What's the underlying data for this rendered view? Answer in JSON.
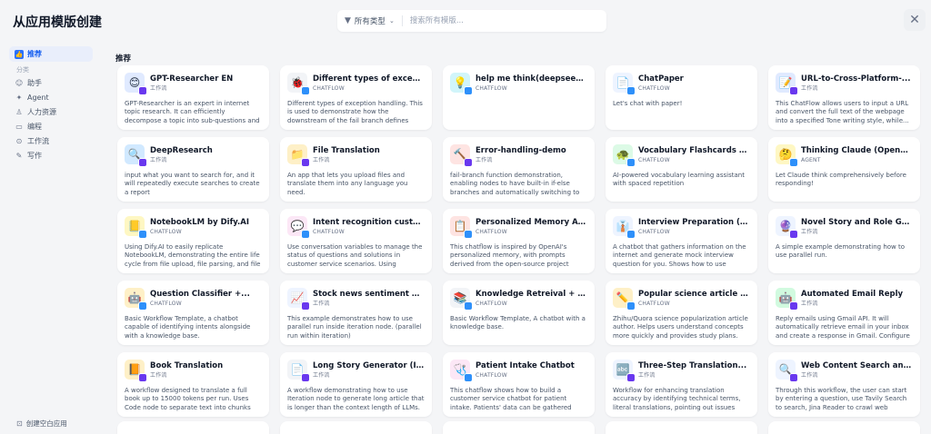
{
  "modal": {
    "title": "从应用模版创建",
    "close_icon": "close-icon"
  },
  "search": {
    "type_label": "所有类型",
    "placeholder": "搜索所有模版..."
  },
  "sidebar": {
    "recommended": "推荐",
    "category_label": "分类",
    "items": [
      {
        "label": "助手",
        "icon": "assistant-icon"
      },
      {
        "label": "Agent",
        "icon": "agent-icon"
      },
      {
        "label": "人力资源",
        "icon": "hr-icon"
      },
      {
        "label": "编程",
        "icon": "code-icon"
      },
      {
        "label": "工作流",
        "icon": "workflow-icon"
      },
      {
        "label": "写作",
        "icon": "writing-icon"
      }
    ],
    "create_blank": "创建空白应用"
  },
  "section_title": "推荐",
  "colors": {
    "accent": "#155eef",
    "workflow_badge": "#6938ef",
    "chatflow_badge": "#2e90fa"
  },
  "cards": [
    {
      "title": "GPT-Researcher EN",
      "type": "工作流",
      "desc": "GPT-Researcher is an expert in internet topic research. It can efficiently decompose a topic into sub-questions and provide a professional...",
      "icon": "😊",
      "bg": "#e0eaff",
      "badge": "wf"
    },
    {
      "title": "Different types of exception...",
      "type": "CHATFLOW",
      "desc": "Different types of exception handling. This is used to demonstrate how the downstream of the fail branch defines different strategies...",
      "icon": "🐞",
      "bg": "#f2f4f7",
      "badge": "cf"
    },
    {
      "title": "help me think(deepseek r1)",
      "type": "CHATFLOW",
      "desc": "",
      "icon": "💡",
      "bg": "#d1f5fa",
      "badge": "cf"
    },
    {
      "title": "ChatPaper",
      "type": "CHATFLOW",
      "desc": "Let's chat with paper!",
      "icon": "📄",
      "bg": "#eef4ff",
      "badge": "cf"
    },
    {
      "title": "URL-to-Cross-Platform-...",
      "type": "工作流",
      "desc": "This ChatFlow allows users to input a URL and convert the full text of the webpage into a specified Tone writing style, while...",
      "icon": "📝",
      "bg": "#e0eaff",
      "badge": "wf"
    },
    {
      "title": "DeepResearch",
      "type": "工作流",
      "desc": "input what you want to search for, and it will repeatedly execute searches to create a report",
      "icon": "🔍",
      "bg": "#d1e9ff",
      "badge": "wf"
    },
    {
      "title": "File Translation",
      "type": "工作流",
      "desc": "An app that lets you upload files and translate them into any language you need.",
      "icon": "📁",
      "bg": "#fef0c7",
      "badge": "wf"
    },
    {
      "title": "Error-handling-demo",
      "type": "工作流",
      "desc": "fail-branch function demonstration, enabling nodes to have built-in if-else branches and automatically switching to the failure branch...",
      "icon": "🔨",
      "bg": "#fee4e2",
      "badge": "wf"
    },
    {
      "title": "Vocabulary Flashcards (chatflo...",
      "type": "CHATFLOW",
      "desc": "AI-powered vocabulary learning assistant with spaced repetition",
      "icon": "🐢",
      "bg": "#dcfae6",
      "badge": "cf"
    },
    {
      "title": "Thinking Claude (OpenAI O1...",
      "type": "AGENT",
      "desc": "Let Claude think comprehensively before responding!",
      "icon": "🤔",
      "bg": "#fef7c3",
      "badge": "cf"
    },
    {
      "title": "NotebookLM by Dify.AI",
      "type": "CHATFLOW",
      "desc": "Using Dify.AI to easily replicate NotebookLM, demonstrating the entire life cycle from file upload, file parsing, and file referencing to file...",
      "icon": "📒",
      "bg": "#fef7c3",
      "badge": "cf"
    },
    {
      "title": "Intent recognition customer...",
      "type": "CHATFLOW",
      "desc": "Use conversation variables to manage the status of questions and solutions in customer service scenarios. Using conversation variable and...",
      "icon": "💬",
      "bg": "#fce7f6",
      "badge": "cf"
    },
    {
      "title": "Personalized Memory Assistant",
      "type": "CHATFLOW",
      "desc": "This chatflow is inspired by OpenAI's personalized memory, with prompts derived from the open-source project mem0ai.",
      "icon": "📋",
      "bg": "#fee4e2",
      "badge": "cf"
    },
    {
      "title": "Interview Preparation (IF/ELSE...",
      "type": "CHATFLOW",
      "desc": "A chatbot that gathers information on the internet and generate mock interview question for you. Shows how to use IF/ELSE and parallel...",
      "icon": "👔",
      "bg": "#eef4ff",
      "badge": "cf"
    },
    {
      "title": "Novel Story and Role Generat...",
      "type": "工作流",
      "desc": "A simple example demonstrating how to use parallel run.",
      "icon": "🔮",
      "bg": "#eef4ff",
      "badge": "wf"
    },
    {
      "title": "Question Classifier +...",
      "type": "CHATFLOW",
      "desc": "Basic Workflow Template, a chatbot capable of identifying intents alongside with a knowledge base.",
      "icon": "🤖",
      "bg": "#fef0c7",
      "badge": "cf"
    },
    {
      "title": "Stock news sentiment analysis...",
      "type": "工作流",
      "desc": "This example demonstrates how to use parallel run inside iteration node. (parallel run within iteration)",
      "icon": "📈",
      "bg": "#eef4ff",
      "badge": "wf"
    },
    {
      "title": "Knowledge Retreival + Chatbot",
      "type": "CHATFLOW",
      "desc": "Basic Workflow Template, A chatbot with a knowledge base.",
      "icon": "📚",
      "bg": "#f2f4f7",
      "badge": "cf"
    },
    {
      "title": "Popular science article author...",
      "type": "CHATFLOW",
      "desc": "Zhihu/Quora science popularization article author. Helps users understand concepts more quickly and provides study plans. (nested...",
      "icon": "✏️",
      "bg": "#fef0c7",
      "badge": "cf"
    },
    {
      "title": "Automated Email Reply",
      "type": "工作流",
      "desc": "Reply emails using Gmail API. It will automatically retrieve email in your inbox and create a response in Gmail. Configure your Gm...",
      "icon": "🤖",
      "bg": "#d1fadf",
      "badge": "wf"
    },
    {
      "title": "Book Translation",
      "type": "工作流",
      "desc": "A workflow designed to translate a full book up to 15000 tokens per run. Uses Code node to separate text into chunks and Iteration to...",
      "icon": "📙",
      "bg": "#fef0c7",
      "badge": "wf"
    },
    {
      "title": "Long Story Generator (Iteration)",
      "type": "工作流",
      "desc": "A workflow demonstrating how to use Iteration node to generate long article that is longer than the context length of LLMs.",
      "icon": "📄",
      "bg": "#f2f4f7",
      "badge": "wf"
    },
    {
      "title": "Patient Intake Chatbot",
      "type": "CHATFLOW",
      "desc": "This chatflow shows how to build a customer service chatbot for patient intake. Patients' data can be gathered through interactive sessions o...",
      "icon": "🩺",
      "bg": "#fce7f6",
      "badge": "cf"
    },
    {
      "title": "Three-Step Translation...",
      "type": "工作流",
      "desc": "Workflow for enhancing translation accuracy by identifying technical terms, literal translations, pointing out issues with literal translations, an...",
      "icon": "🔤",
      "bg": "#eef4ff",
      "badge": "wf"
    },
    {
      "title": "Web Content Search and...",
      "type": "工作流",
      "desc": "Through this workflow, the user can start by entering a question, use Tavily Search to search, Jina Reader to crawl web content, and generat...",
      "icon": "🔍",
      "bg": "#eef4ff",
      "badge": "wf"
    }
  ]
}
